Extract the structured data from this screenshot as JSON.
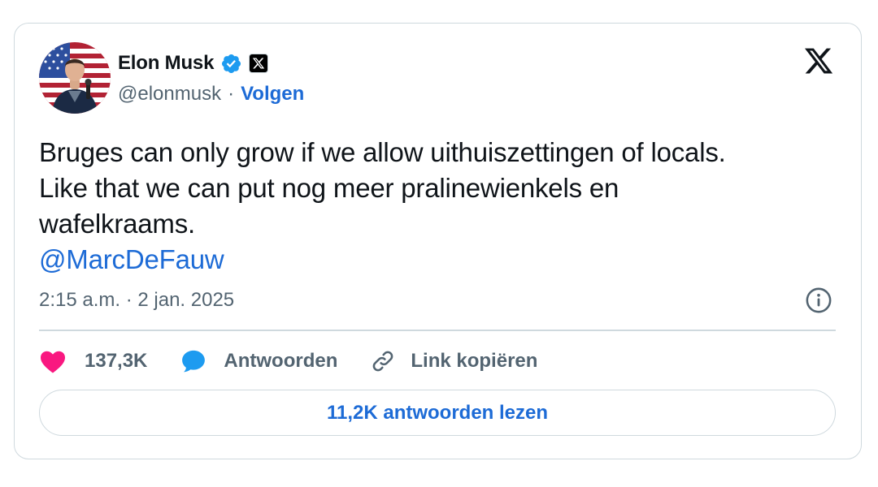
{
  "author": {
    "name": "Elon Musk",
    "handle": "@elonmusk",
    "separator": "·",
    "follow_label": "Volgen"
  },
  "tweet": {
    "lines": [
      "Bruges can only grow if we allow uithuiszettingen of locals.",
      "Like that we can put nog meer pralinewienkels en",
      "wafelkraams."
    ],
    "mention": "@MarcDeFauw",
    "timestamp": "2:15 a.m. · 2 jan. 2025"
  },
  "actions": {
    "likes": "137,3K",
    "reply_label": "Antwoorden",
    "copy_label": "Link kopiëren"
  },
  "read_replies_label": "11,2K antwoorden lezen",
  "icons": {
    "verified": "verified-badge-icon",
    "affiliate": "x-affiliate-badge-icon",
    "brand": "x-logo-icon",
    "info": "info-icon",
    "like": "heart-icon",
    "reply": "reply-bubble-icon",
    "copy": "link-icon"
  },
  "colors": {
    "link_blue": "#1d6bd6",
    "verified_blue": "#1d9bf0",
    "like_pink": "#f91880",
    "muted_text": "#536471",
    "border": "#cfd9de"
  }
}
